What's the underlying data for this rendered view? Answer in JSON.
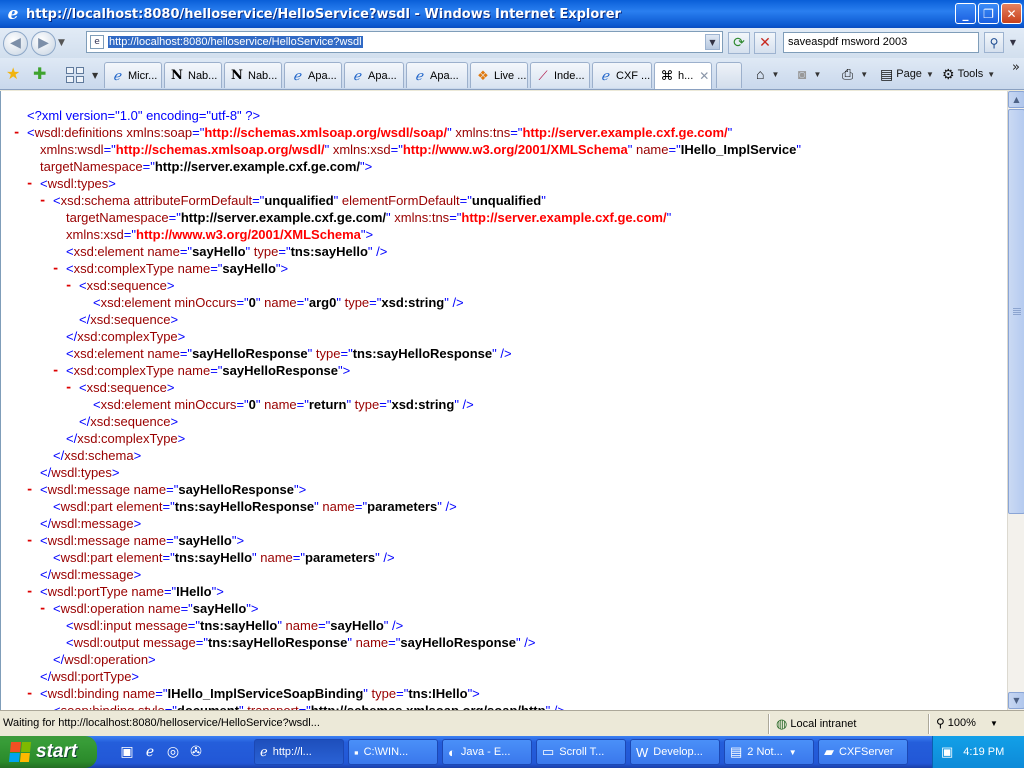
{
  "window": {
    "title": "http://localhost:8080/helloservice/HelloService?wsdl - Windows Internet Explorer",
    "buttons": [
      "_",
      "❐",
      "✕"
    ]
  },
  "address_bar": {
    "url": "http://localhost:8080/helloservice/HelloService?wsdl",
    "search_value": "saveaspdf msword 2003"
  },
  "tabs": [
    {
      "icon": "ie-icon",
      "label": "Micr..."
    },
    {
      "icon": "n-icon",
      "label": "Nab..."
    },
    {
      "icon": "n-icon",
      "label": "Nab..."
    },
    {
      "icon": "ie-page-icon",
      "label": "Apa..."
    },
    {
      "icon": "ie-page-icon",
      "label": "Apa..."
    },
    {
      "icon": "ie-icon",
      "label": "Apa..."
    },
    {
      "icon": "windows-icon",
      "label": "Live ..."
    },
    {
      "icon": "feather-icon",
      "label": "Inde..."
    },
    {
      "icon": "ie-page-icon",
      "label": "CXF ..."
    },
    {
      "icon": "xml-icon",
      "label": "h..."
    }
  ],
  "command_bar": {
    "page_label": "Page",
    "tools_label": "Tools"
  },
  "xml_lines": [
    {
      "parts": [
        [
          "pi",
          "<?xml version=\"1.0\" encoding=\"utf-8\" ?>"
        ]
      ]
    },
    {
      "minus": true,
      "parts": [
        [
          "t",
          "<"
        ],
        [
          "tn",
          "wsdl:definitions"
        ],
        [
          "t",
          " "
        ],
        [
          "n",
          "xmlns:soap"
        ],
        [
          "t",
          "=\""
        ],
        [
          "ns",
          "http://schemas.xmlsoap.org/wsdl/soap/"
        ],
        [
          "t",
          "\" "
        ],
        [
          "n",
          "xmlns:tns"
        ],
        [
          "t",
          "=\""
        ],
        [
          "ns",
          "http://server.example.cxf.ge.com/"
        ],
        [
          "t",
          "\""
        ]
      ]
    },
    {
      "parts": [
        [
          "n",
          "xmlns:wsdl"
        ],
        [
          "t",
          "=\""
        ],
        [
          "ns",
          "http://schemas.xmlsoap.org/wsdl/"
        ],
        [
          "t",
          "\" "
        ],
        [
          "n",
          "xmlns:xsd"
        ],
        [
          "t",
          "=\""
        ],
        [
          "ns",
          "http://www.w3.org/2001/XMLSchema"
        ],
        [
          "t",
          "\" "
        ],
        [
          "n",
          "name"
        ],
        [
          "t",
          "=\""
        ],
        [
          "b",
          "IHello_ImplService"
        ],
        [
          "t",
          "\""
        ]
      ]
    },
    {
      "parts": [
        [
          "n",
          "targetNamespace"
        ],
        [
          "t",
          "=\""
        ],
        [
          "b",
          "http://server.example.cxf.ge.com/"
        ],
        [
          "t",
          "\">"
        ]
      ]
    },
    {
      "minus": true,
      "parts": [
        [
          "t",
          "<"
        ],
        [
          "tn",
          "wsdl:types"
        ],
        [
          "t",
          ">"
        ]
      ]
    },
    {
      "minus": true,
      "parts": [
        [
          "t",
          "<"
        ],
        [
          "tn",
          "xsd:schema"
        ],
        [
          "t",
          " "
        ],
        [
          "n",
          "attributeFormDefault"
        ],
        [
          "t",
          "=\""
        ],
        [
          "b",
          "unqualified"
        ],
        [
          "t",
          "\" "
        ],
        [
          "n",
          "elementFormDefault"
        ],
        [
          "t",
          "=\""
        ],
        [
          "b",
          "unqualified"
        ],
        [
          "t",
          "\""
        ]
      ]
    },
    {
      "parts": [
        [
          "n",
          "targetNamespace"
        ],
        [
          "t",
          "=\""
        ],
        [
          "b",
          "http://server.example.cxf.ge.com/"
        ],
        [
          "t",
          "\" "
        ],
        [
          "n",
          "xmlns:tns"
        ],
        [
          "t",
          "=\""
        ],
        [
          "ns",
          "http://server.example.cxf.ge.com/"
        ],
        [
          "t",
          "\""
        ]
      ]
    },
    {
      "parts": [
        [
          "n",
          "xmlns:xsd"
        ],
        [
          "t",
          "=\""
        ],
        [
          "ns",
          "http://www.w3.org/2001/XMLSchema"
        ],
        [
          "t",
          "\">"
        ]
      ]
    },
    {
      "parts": [
        [
          "t",
          "<"
        ],
        [
          "tn",
          "xsd:element"
        ],
        [
          "t",
          " "
        ],
        [
          "n",
          "name"
        ],
        [
          "t",
          "=\""
        ],
        [
          "b",
          "sayHello"
        ],
        [
          "t",
          "\" "
        ],
        [
          "n",
          "type"
        ],
        [
          "t",
          "=\""
        ],
        [
          "b",
          "tns:sayHello"
        ],
        [
          "t",
          "\" />"
        ]
      ]
    },
    {
      "minus": true,
      "parts": [
        [
          "t",
          "<"
        ],
        [
          "tn",
          "xsd:complexType"
        ],
        [
          "t",
          " "
        ],
        [
          "n",
          "name"
        ],
        [
          "t",
          "=\""
        ],
        [
          "b",
          "sayHello"
        ],
        [
          "t",
          "\">"
        ]
      ]
    },
    {
      "minus": true,
      "parts": [
        [
          "t",
          "<"
        ],
        [
          "tn",
          "xsd:sequence"
        ],
        [
          "t",
          ">"
        ]
      ]
    },
    {
      "parts": [
        [
          "t",
          "<"
        ],
        [
          "tn",
          "xsd:element"
        ],
        [
          "t",
          " "
        ],
        [
          "n",
          "minOccurs"
        ],
        [
          "t",
          "=\""
        ],
        [
          "b",
          "0"
        ],
        [
          "t",
          "\" "
        ],
        [
          "n",
          "name"
        ],
        [
          "t",
          "=\""
        ],
        [
          "b",
          "arg0"
        ],
        [
          "t",
          "\" "
        ],
        [
          "n",
          "type"
        ],
        [
          "t",
          "=\""
        ],
        [
          "b",
          "xsd:string"
        ],
        [
          "t",
          "\" />"
        ]
      ]
    },
    {
      "parts": [
        [
          "t",
          "</"
        ],
        [
          "tn",
          "xsd:sequence"
        ],
        [
          "t",
          ">"
        ]
      ]
    },
    {
      "parts": [
        [
          "t",
          "</"
        ],
        [
          "tn",
          "xsd:complexType"
        ],
        [
          "t",
          ">"
        ]
      ]
    },
    {
      "parts": [
        [
          "t",
          "<"
        ],
        [
          "tn",
          "xsd:element"
        ],
        [
          "t",
          " "
        ],
        [
          "n",
          "name"
        ],
        [
          "t",
          "=\""
        ],
        [
          "b",
          "sayHelloResponse"
        ],
        [
          "t",
          "\" "
        ],
        [
          "n",
          "type"
        ],
        [
          "t",
          "=\""
        ],
        [
          "b",
          "tns:sayHelloResponse"
        ],
        [
          "t",
          "\" />"
        ]
      ]
    },
    {
      "minus": true,
      "parts": [
        [
          "t",
          "<"
        ],
        [
          "tn",
          "xsd:complexType"
        ],
        [
          "t",
          " "
        ],
        [
          "n",
          "name"
        ],
        [
          "t",
          "=\""
        ],
        [
          "b",
          "sayHelloResponse"
        ],
        [
          "t",
          "\">"
        ]
      ]
    },
    {
      "minus": true,
      "parts": [
        [
          "t",
          "<"
        ],
        [
          "tn",
          "xsd:sequence"
        ],
        [
          "t",
          ">"
        ]
      ]
    },
    {
      "parts": [
        [
          "t",
          "<"
        ],
        [
          "tn",
          "xsd:element"
        ],
        [
          "t",
          " "
        ],
        [
          "n",
          "minOccurs"
        ],
        [
          "t",
          "=\""
        ],
        [
          "b",
          "0"
        ],
        [
          "t",
          "\" "
        ],
        [
          "n",
          "name"
        ],
        [
          "t",
          "=\""
        ],
        [
          "b",
          "return"
        ],
        [
          "t",
          "\" "
        ],
        [
          "n",
          "type"
        ],
        [
          "t",
          "=\""
        ],
        [
          "b",
          "xsd:string"
        ],
        [
          "t",
          "\" />"
        ]
      ]
    },
    {
      "parts": [
        [
          "t",
          "</"
        ],
        [
          "tn",
          "xsd:sequence"
        ],
        [
          "t",
          ">"
        ]
      ]
    },
    {
      "parts": [
        [
          "t",
          "</"
        ],
        [
          "tn",
          "xsd:complexType"
        ],
        [
          "t",
          ">"
        ]
      ]
    },
    {
      "parts": [
        [
          "t",
          "</"
        ],
        [
          "tn",
          "xsd:schema"
        ],
        [
          "t",
          ">"
        ]
      ]
    },
    {
      "parts": [
        [
          "t",
          "</"
        ],
        [
          "tn",
          "wsdl:types"
        ],
        [
          "t",
          ">"
        ]
      ]
    },
    {
      "minus": true,
      "parts": [
        [
          "t",
          "<"
        ],
        [
          "tn",
          "wsdl:message"
        ],
        [
          "t",
          " "
        ],
        [
          "n",
          "name"
        ],
        [
          "t",
          "=\""
        ],
        [
          "b",
          "sayHelloResponse"
        ],
        [
          "t",
          "\">"
        ]
      ]
    },
    {
      "parts": [
        [
          "t",
          "<"
        ],
        [
          "tn",
          "wsdl:part"
        ],
        [
          "t",
          " "
        ],
        [
          "n",
          "element"
        ],
        [
          "t",
          "=\""
        ],
        [
          "b",
          "tns:sayHelloResponse"
        ],
        [
          "t",
          "\" "
        ],
        [
          "n",
          "name"
        ],
        [
          "t",
          "=\""
        ],
        [
          "b",
          "parameters"
        ],
        [
          "t",
          "\" />"
        ]
      ]
    },
    {
      "parts": [
        [
          "t",
          "</"
        ],
        [
          "tn",
          "wsdl:message"
        ],
        [
          "t",
          ">"
        ]
      ]
    },
    {
      "minus": true,
      "parts": [
        [
          "t",
          "<"
        ],
        [
          "tn",
          "wsdl:message"
        ],
        [
          "t",
          " "
        ],
        [
          "n",
          "name"
        ],
        [
          "t",
          "=\""
        ],
        [
          "b",
          "sayHello"
        ],
        [
          "t",
          "\">"
        ]
      ]
    },
    {
      "parts": [
        [
          "t",
          "<"
        ],
        [
          "tn",
          "wsdl:part"
        ],
        [
          "t",
          " "
        ],
        [
          "n",
          "element"
        ],
        [
          "t",
          "=\""
        ],
        [
          "b",
          "tns:sayHello"
        ],
        [
          "t",
          "\" "
        ],
        [
          "n",
          "name"
        ],
        [
          "t",
          "=\""
        ],
        [
          "b",
          "parameters"
        ],
        [
          "t",
          "\" />"
        ]
      ]
    },
    {
      "parts": [
        [
          "t",
          "</"
        ],
        [
          "tn",
          "wsdl:message"
        ],
        [
          "t",
          ">"
        ]
      ]
    },
    {
      "minus": true,
      "parts": [
        [
          "t",
          "<"
        ],
        [
          "tn",
          "wsdl:portType"
        ],
        [
          "t",
          " "
        ],
        [
          "n",
          "name"
        ],
        [
          "t",
          "=\""
        ],
        [
          "b",
          "IHello"
        ],
        [
          "t",
          "\">"
        ]
      ]
    },
    {
      "minus": true,
      "parts": [
        [
          "t",
          "<"
        ],
        [
          "tn",
          "wsdl:operation"
        ],
        [
          "t",
          " "
        ],
        [
          "n",
          "name"
        ],
        [
          "t",
          "=\""
        ],
        [
          "b",
          "sayHello"
        ],
        [
          "t",
          "\">"
        ]
      ]
    },
    {
      "parts": [
        [
          "t",
          "<"
        ],
        [
          "tn",
          "wsdl:input"
        ],
        [
          "t",
          " "
        ],
        [
          "n",
          "message"
        ],
        [
          "t",
          "=\""
        ],
        [
          "b",
          "tns:sayHello"
        ],
        [
          "t",
          "\" "
        ],
        [
          "n",
          "name"
        ],
        [
          "t",
          "=\""
        ],
        [
          "b",
          "sayHello"
        ],
        [
          "t",
          "\" />"
        ]
      ]
    },
    {
      "parts": [
        [
          "t",
          "<"
        ],
        [
          "tn",
          "wsdl:output"
        ],
        [
          "t",
          " "
        ],
        [
          "n",
          "message"
        ],
        [
          "t",
          "=\""
        ],
        [
          "b",
          "tns:sayHelloResponse"
        ],
        [
          "t",
          "\" "
        ],
        [
          "n",
          "name"
        ],
        [
          "t",
          "=\""
        ],
        [
          "b",
          "sayHelloResponse"
        ],
        [
          "t",
          "\" />"
        ]
      ]
    },
    {
      "parts": [
        [
          "t",
          "</"
        ],
        [
          "tn",
          "wsdl:operation"
        ],
        [
          "t",
          ">"
        ]
      ]
    },
    {
      "parts": [
        [
          "t",
          "</"
        ],
        [
          "tn",
          "wsdl:portType"
        ],
        [
          "t",
          ">"
        ]
      ]
    },
    {
      "minus": true,
      "parts": [
        [
          "t",
          "<"
        ],
        [
          "tn",
          "wsdl:binding"
        ],
        [
          "t",
          " "
        ],
        [
          "n",
          "name"
        ],
        [
          "t",
          "=\""
        ],
        [
          "b",
          "IHello_ImplServiceSoapBinding"
        ],
        [
          "t",
          "\" "
        ],
        [
          "n",
          "type"
        ],
        [
          "t",
          "=\""
        ],
        [
          "b",
          "tns:IHello"
        ],
        [
          "t",
          "\">"
        ]
      ]
    },
    {
      "parts": [
        [
          "t",
          "<"
        ],
        [
          "tn",
          "soap:binding"
        ],
        [
          "t",
          " "
        ],
        [
          "n",
          "style"
        ],
        [
          "t",
          "=\""
        ],
        [
          "b",
          "document"
        ],
        [
          "t",
          "\" "
        ],
        [
          "n",
          "transport"
        ],
        [
          "t",
          "=\""
        ],
        [
          "b",
          "http://schemas.xmlsoap.org/soap/http"
        ],
        [
          "t",
          "\" />"
        ]
      ]
    }
  ],
  "status_bar": {
    "message": "Waiting for http://localhost:8080/helloservice/HelloService?wsdl...",
    "zone": "Local intranet",
    "zoom": "100%"
  },
  "taskbar": {
    "start_label": "start",
    "tasks": [
      {
        "icon": "ie-icon",
        "label": "http://l..."
      },
      {
        "icon": "cmd-icon",
        "label": "C:\\WIN..."
      },
      {
        "icon": "eclipse-icon",
        "label": "Java - E..."
      },
      {
        "icon": "window-icon",
        "label": "Scroll T..."
      },
      {
        "icon": "word-icon",
        "label": "Develop..."
      },
      {
        "icon": "notepad-icon",
        "label": "2 Not..."
      },
      {
        "icon": "folder-icon",
        "label": "CXFServer"
      }
    ],
    "clock": "4:19 PM"
  },
  "colors": {
    "tag": "#0000ff",
    "attr_name": "#990000",
    "namespace_value": "#ff0000",
    "collapse_marker": "#dd0000"
  }
}
